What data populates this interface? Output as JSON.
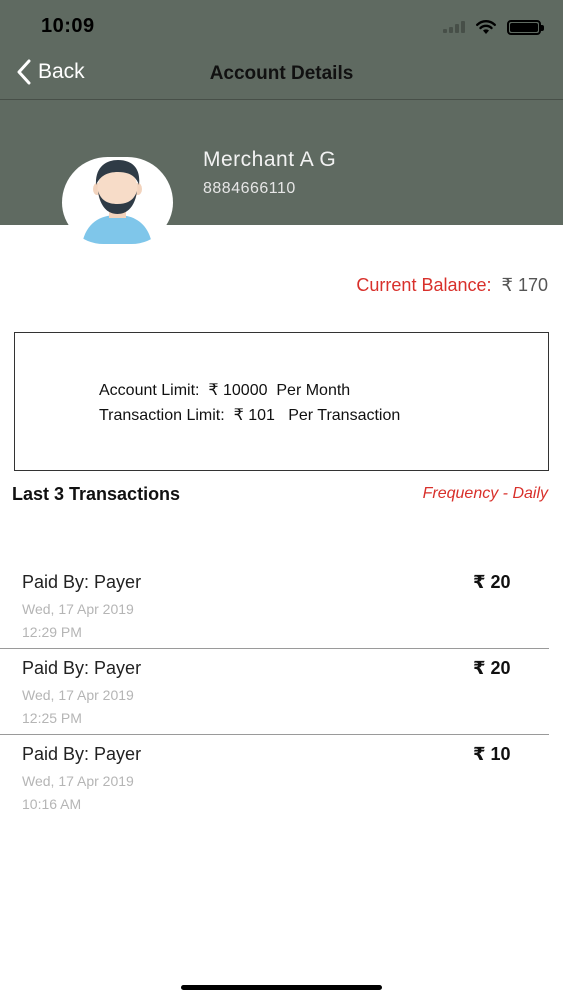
{
  "status_bar": {
    "time": "10:09"
  },
  "nav": {
    "back_label": "Back",
    "title": "Account Details"
  },
  "merchant": {
    "name": "Merchant A G",
    "phone": "8884666110"
  },
  "balance": {
    "label": "Current Balance:",
    "value": "₹ 170"
  },
  "limits": {
    "account": "Account Limit:  ₹ 10000  Per Month",
    "transaction": "Transaction Limit:  ₹ 101   Per Transaction"
  },
  "transactions_section": {
    "title": "Last 3 Transactions",
    "frequency": "Frequency - Daily"
  },
  "transactions": [
    {
      "payer": "Paid By: Payer",
      "date": "Wed, 17 Apr 2019",
      "time": "12:29 PM",
      "amount": "₹ 20"
    },
    {
      "payer": "Paid By: Payer",
      "date": "Wed, 17 Apr 2019",
      "time": "12:25 PM",
      "amount": "₹ 20"
    },
    {
      "payer": "Paid By: Payer",
      "date": "Wed, 17 Apr 2019",
      "time": "10:16 AM",
      "amount": "₹ 10"
    }
  ],
  "colors": {
    "header": "#5f6a61",
    "accent_red": "#d8302b"
  },
  "icons": [
    "signal-icon",
    "wifi-icon",
    "battery-icon",
    "back-chevron-icon",
    "avatar-icon"
  ]
}
